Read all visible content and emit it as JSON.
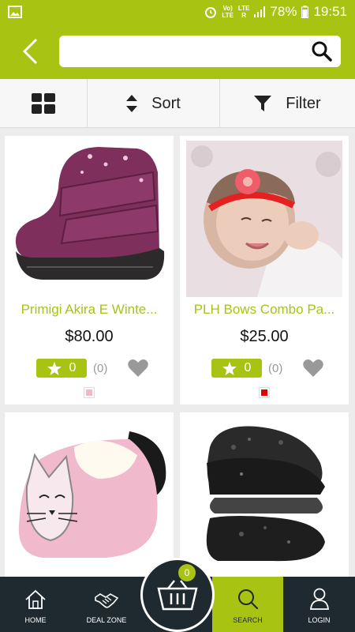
{
  "status_bar": {
    "volte_top": "Vo)",
    "volte_bottom": "LTE",
    "lte_top": "LTE",
    "lte_bottom": "R",
    "battery": "78%",
    "time": "19:51"
  },
  "search": {
    "value": "",
    "placeholder": ""
  },
  "toolbar": {
    "sort_label": "Sort",
    "filter_label": "Filter"
  },
  "products": [
    {
      "name": "Primigi Akira E Winte...",
      "price": "$80.00",
      "rating": "0",
      "reviews": "(0)",
      "swatch_color": "#f4b7c4",
      "image": "purple-baby-boot-image"
    },
    {
      "name": "PLH Bows Combo Pa...",
      "price": "$25.00",
      "rating": "0",
      "reviews": "(0)",
      "swatch_color": "#e00000",
      "image": "baby-with-red-headband-image"
    },
    {
      "name": "",
      "price": "",
      "image": "pink-cat-slipper-image"
    },
    {
      "name": "",
      "price": "",
      "image": "black-fur-boot-image"
    }
  ],
  "cart": {
    "count": "0"
  },
  "nav": {
    "home": "HOME",
    "deal_zone": "DEAL ZONE",
    "search": "SEARCH",
    "login": "LOGIN"
  },
  "colors": {
    "accent": "#a9c313",
    "nav_bg": "#1f2a30"
  }
}
